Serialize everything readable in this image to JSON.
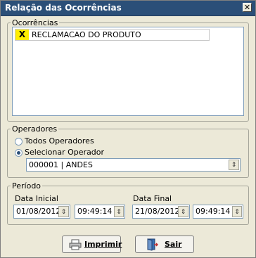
{
  "window": {
    "title": "Relação das Ocorrências"
  },
  "ocorrencias": {
    "legend": "Ocorrências",
    "items": [
      {
        "mark": "X",
        "label": "RECLAMACAO DO PRODUTO"
      }
    ]
  },
  "operadores": {
    "legend": "Operadores",
    "options": [
      "Todos Operadores",
      "Selecionar Operador"
    ],
    "selected": "Selecionar Operador",
    "operator_value": "000001 | ANDES"
  },
  "periodo": {
    "legend": "Período",
    "inicial_label": "Data Inicial",
    "final_label": "Data Final",
    "inicial_date": "01/08/2012",
    "inicial_time": "09:49:14",
    "final_date": "21/08/2012",
    "final_time": "09:49:14"
  },
  "buttons": {
    "imprimir": "Imprimir",
    "sair": "Sair"
  },
  "icons": {
    "close": "close-icon",
    "printer": "printer-icon",
    "exit": "exit-door-icon"
  }
}
